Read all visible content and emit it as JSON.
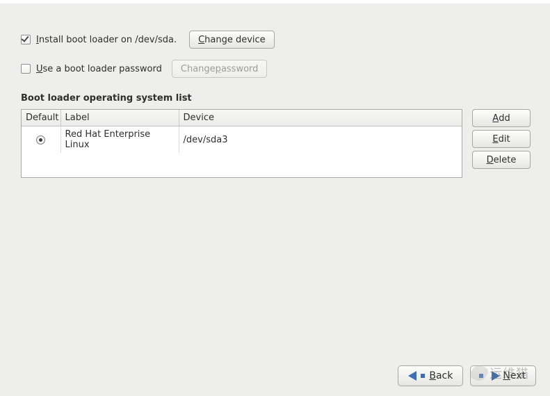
{
  "install": {
    "checked": true,
    "label_pre": "I",
    "label_rest": "nstall boot loader on /dev/sda.",
    "change_device_mn": "C",
    "change_device_rest": "hange device"
  },
  "password": {
    "checked": false,
    "label_pre": "U",
    "label_rest": "se a boot loader password",
    "change_pw_pre": "Change ",
    "change_pw_mn": "p",
    "change_pw_rest": "assword",
    "enabled": false
  },
  "section_title": "Boot loader operating system list",
  "columns": {
    "default": "Default",
    "label": "Label",
    "device": "Device"
  },
  "entries": [
    {
      "default": true,
      "label": "Red Hat Enterprise Linux",
      "device": "/dev/sda3"
    }
  ],
  "side": {
    "add_mn": "A",
    "add_rest": "dd",
    "edit_mn": "E",
    "edit_rest": "dit",
    "del_mn": "D",
    "del_rest": "elete"
  },
  "footer": {
    "back_mn": "B",
    "back_rest": "ack",
    "next_mn": "N",
    "next_rest": "ext"
  },
  "watermark": "运维猫"
}
